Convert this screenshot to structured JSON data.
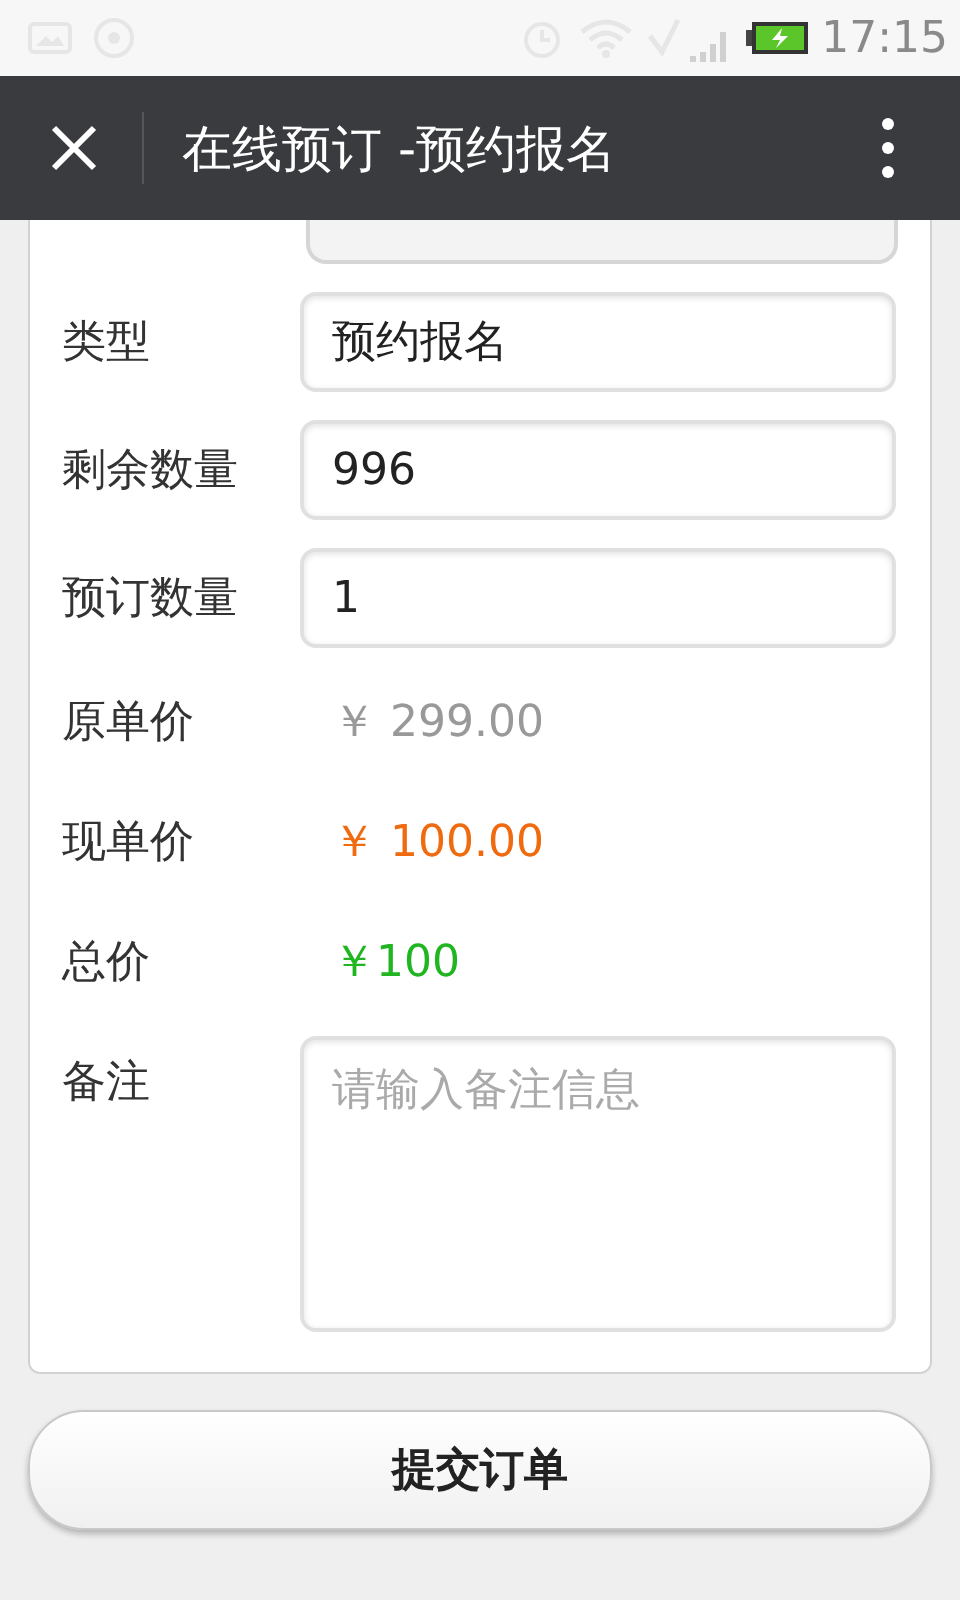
{
  "status_bar": {
    "time": "17:15"
  },
  "header": {
    "title": "在线预订 -预约报名"
  },
  "form": {
    "rows": [
      {
        "kind": "field",
        "label": "类型",
        "value": "预约报名"
      },
      {
        "kind": "field",
        "label": "剩余数量",
        "value": "996"
      },
      {
        "kind": "field",
        "label": "预订数量",
        "value": "1"
      },
      {
        "kind": "price",
        "label": "原单价",
        "value": "￥ 299.00",
        "color": "#999999"
      },
      {
        "kind": "price",
        "label": "现单价",
        "value": "￥ 100.00",
        "color": "#f06a0f"
      },
      {
        "kind": "price",
        "label": "总价",
        "value": "￥100",
        "color": "#22b522"
      },
      {
        "kind": "textarea",
        "label": "备注",
        "placeholder": "请输入备注信息"
      }
    ]
  },
  "submit_button": "提交订单"
}
